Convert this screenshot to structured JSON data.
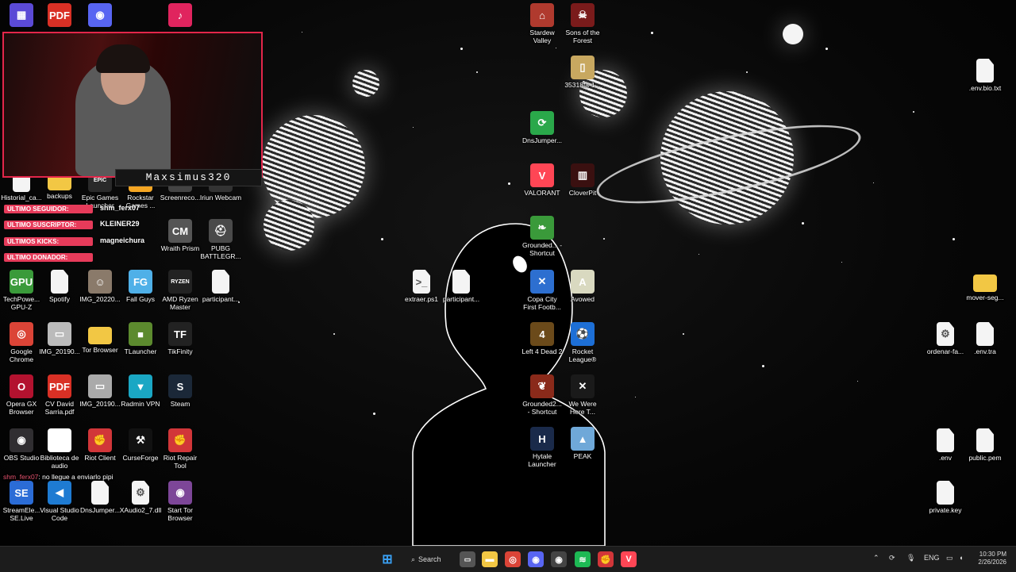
{
  "stream": {
    "streamer_name": "Maxsimus320",
    "alerts": [
      {
        "label": "ULTIMO SEGUIDOR:",
        "value": "shm_ferx07"
      },
      {
        "label": "ULTIMO SUSCRIPTOR:",
        "value": "KLEINER29"
      },
      {
        "label": "ULTIMOS KICKS:",
        "value": "magneichura"
      },
      {
        "label": "ULTIMO DONADOR:",
        "value": ""
      }
    ],
    "chat": {
      "user": "shm_ferx07",
      "message": ": no llegue a enviarlo pipi"
    }
  },
  "desktop_icons": [
    {
      "label": "",
      "icon": "app-grid-icon",
      "color": "#5b4ad6",
      "glyph": "▦"
    },
    {
      "label": "",
      "icon": "pdf-icon",
      "color": "#d93025",
      "glyph": "PDF"
    },
    {
      "label": "",
      "icon": "discord-icon",
      "color": "#5865f2",
      "glyph": "◉"
    },
    {
      "label": "",
      "icon": "tiktok-icon",
      "color": "#e0245e",
      "glyph": "♪"
    },
    {
      "label": "Historial_ca...",
      "icon": "file-icon",
      "color": "#f4f4f4",
      "glyph": ""
    },
    {
      "label": "backups",
      "icon": "folder-icon",
      "color": "#f2c744",
      "glyph": ""
    },
    {
      "label": "Epic Games Launcher",
      "icon": "epic-games-icon",
      "color": "#2a2a2a",
      "glyph": "EPIC"
    },
    {
      "label": "Rockstar Games ...",
      "icon": "rockstar-icon",
      "color": "#f5a623",
      "glyph": "R"
    },
    {
      "label": "Screenreco...",
      "icon": "recorder-icon",
      "color": "#444",
      "glyph": "●"
    },
    {
      "label": "Iriun Webcam",
      "icon": "webcam-icon",
      "color": "#333",
      "glyph": "◎"
    },
    {
      "label": "Wraith Prism",
      "icon": "cooler-master-icon",
      "color": "#555",
      "glyph": "CM"
    },
    {
      "label": "PUBG BATTLEGR...",
      "icon": "pubg-icon",
      "color": "#4a4a4a",
      "glyph": "⛑"
    },
    {
      "label": "TechPowe... GPU-Z",
      "icon": "gpuz-icon",
      "color": "#3a9a3a",
      "glyph": "GPU"
    },
    {
      "label": "Spotify",
      "icon": "file-icon",
      "color": "#f4f4f4",
      "glyph": ""
    },
    {
      "label": "IMG_20220...",
      "icon": "image-icon",
      "color": "#8a7a6a",
      "glyph": "☺"
    },
    {
      "label": "Fall Guys",
      "icon": "fall-guys-icon",
      "color": "#4fb0e8",
      "glyph": "FG"
    },
    {
      "label": "AMD Ryzen Master",
      "icon": "ryzen-icon",
      "color": "#222",
      "glyph": "RYZEN"
    },
    {
      "label": "participant...",
      "icon": "file-icon",
      "color": "#f4f4f4",
      "glyph": ""
    },
    {
      "label": "Google Chrome",
      "icon": "chrome-icon",
      "color": "#db4437",
      "glyph": "◎"
    },
    {
      "label": "IMG_20190...",
      "icon": "image-icon",
      "color": "#bbb",
      "glyph": "▭"
    },
    {
      "label": "Tor Browser",
      "icon": "folder-icon",
      "color": "#f2c744",
      "glyph": ""
    },
    {
      "label": "TLauncher",
      "icon": "tlauncher-icon",
      "color": "#5c8a2e",
      "glyph": "■"
    },
    {
      "label": "TikFinity",
      "icon": "tikfinity-icon",
      "color": "#222",
      "glyph": "TF"
    },
    {
      "label": "Opera GX Browser",
      "icon": "opera-icon",
      "color": "#b3122f",
      "glyph": "O"
    },
    {
      "label": "CV David Sarria.pdf",
      "icon": "pdf-icon",
      "color": "#d93025",
      "glyph": "PDF"
    },
    {
      "label": "IMG_20190...",
      "icon": "image-icon",
      "color": "#aaa",
      "glyph": "▭"
    },
    {
      "label": "Radmin VPN",
      "icon": "radmin-icon",
      "color": "#1aa7c4",
      "glyph": "▼"
    },
    {
      "label": "Steam",
      "icon": "steam-icon",
      "color": "#1b2838",
      "glyph": "S"
    },
    {
      "label": "OBS Studio",
      "icon": "obs-icon",
      "color": "#302e31",
      "glyph": "◉"
    },
    {
      "label": "Biblioteca de audio",
      "icon": "chrome-icon",
      "color": "#fff",
      "glyph": "◎"
    },
    {
      "label": "Riot Client",
      "icon": "riot-icon",
      "color": "#d13639",
      "glyph": "✊"
    },
    {
      "label": "CurseForge",
      "icon": "curseforge-icon",
      "color": "#111",
      "glyph": "⚒"
    },
    {
      "label": "Riot Repair Tool",
      "icon": "riot-icon",
      "color": "#d13639",
      "glyph": "✊"
    },
    {
      "label": "StreamEle... SE.Live",
      "icon": "streamelements-icon",
      "color": "#2b6cd6",
      "glyph": "SE"
    },
    {
      "label": "Visual Studio Code",
      "icon": "vscode-icon",
      "color": "#1e7bd2",
      "glyph": "◀"
    },
    {
      "label": "DnsJumper...",
      "icon": "file-icon",
      "color": "#f4f4f4",
      "glyph": ""
    },
    {
      "label": "XAudio2_7.dll",
      "icon": "dll-icon",
      "color": "#f4f4f4",
      "glyph": "⚙"
    },
    {
      "label": "Start Tor Browser",
      "icon": "tor-icon",
      "color": "#7d4698",
      "glyph": "◉"
    },
    {
      "label": "extraer.ps1",
      "icon": "script-icon",
      "color": "#f4f4f4",
      "glyph": ">_"
    },
    {
      "label": "participant...",
      "icon": "file-icon",
      "color": "#f4f4f4",
      "glyph": ""
    },
    {
      "label": "Stardew Valley",
      "icon": "stardew-icon",
      "color": "#b03a2e",
      "glyph": "⌂"
    },
    {
      "label": "Sons of the Forest",
      "icon": "sotf-icon",
      "color": "#7a1b1b",
      "glyph": "☠"
    },
    {
      "label": "35318fa-1...",
      "icon": "image-icon",
      "color": "#c8a860",
      "glyph": "▯"
    },
    {
      "label": "DnsJumper...",
      "icon": "dnsjumper-icon",
      "color": "#2aa84a",
      "glyph": "⟳"
    },
    {
      "label": "VALORANT",
      "icon": "valorant-icon",
      "color": "#ff4655",
      "glyph": "V"
    },
    {
      "label": "CloverPit",
      "icon": "cloverpit-icon",
      "color": "#3a1010",
      "glyph": "▥"
    },
    {
      "label": "Grounded... - Shortcut",
      "icon": "grounded-icon",
      "color": "#3a9a3a",
      "glyph": "❧"
    },
    {
      "label": "Copa City First Footb...",
      "icon": "copa-city-icon",
      "color": "#2d6fd0",
      "glyph": "✕"
    },
    {
      "label": "Avowed",
      "icon": "avowed-icon",
      "color": "#d9d9c0",
      "glyph": "A"
    },
    {
      "label": "Left 4 Dead 2",
      "icon": "l4d2-icon",
      "color": "#6b4a1a",
      "glyph": "4"
    },
    {
      "label": "Rocket League®",
      "icon": "rocket-league-icon",
      "color": "#1d6fd6",
      "glyph": "⚽"
    },
    {
      "label": "Grounded2... - Shortcut",
      "icon": "grounded2-icon",
      "color": "#8a2a1a",
      "glyph": "❦"
    },
    {
      "label": "We Were Here T...",
      "icon": "we-were-here-icon",
      "color": "#1a1a1a",
      "glyph": "✕"
    },
    {
      "label": "Hytale Launcher",
      "icon": "hytale-icon",
      "color": "#1a2a4a",
      "glyph": "H"
    },
    {
      "label": "PEAK",
      "icon": "peak-icon",
      "color": "#6fa8d8",
      "glyph": "▲"
    },
    {
      "label": ".env.bio.txt",
      "icon": "text-file-icon",
      "color": "#f4f4f4",
      "glyph": ""
    },
    {
      "label": "mover-seg...",
      "icon": "folder-icon",
      "color": "#f2c744",
      "glyph": ""
    },
    {
      "label": "ordenar-fa...",
      "icon": "settings-file-icon",
      "color": "#f4f4f4",
      "glyph": "⚙"
    },
    {
      "label": ".env.tra",
      "icon": "file-icon",
      "color": "#f4f4f4",
      "glyph": ""
    },
    {
      "label": ".env",
      "icon": "file-icon",
      "color": "#f4f4f4",
      "glyph": ""
    },
    {
      "label": "public.pem",
      "icon": "file-icon",
      "color": "#f4f4f4",
      "glyph": ""
    },
    {
      "label": "private.key",
      "icon": "file-icon",
      "color": "#f4f4f4",
      "glyph": ""
    }
  ],
  "taskbar": {
    "search_label": "Search",
    "apps": [
      {
        "icon": "file-explorer-icon",
        "color": "#f2c744",
        "glyph": "▬"
      },
      {
        "icon": "chrome-icon",
        "color": "#db4437",
        "glyph": "◎"
      },
      {
        "icon": "discord-icon",
        "color": "#5865f2",
        "glyph": "◉"
      },
      {
        "icon": "obs-icon",
        "color": "#444",
        "glyph": "◉"
      },
      {
        "icon": "spotify-icon",
        "color": "#1db954",
        "glyph": "≋"
      },
      {
        "icon": "riot-icon",
        "color": "#d13639",
        "glyph": "✊"
      },
      {
        "icon": "valorant-icon",
        "color": "#ff4655",
        "glyph": "V"
      }
    ],
    "language": "ENG",
    "time": "10:30 PM",
    "date": "2/26/2026"
  }
}
